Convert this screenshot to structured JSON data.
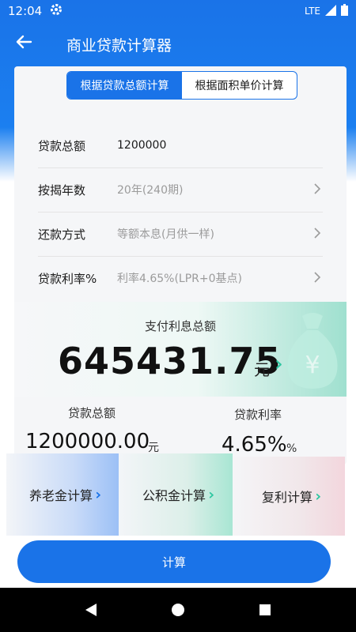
{
  "status": {
    "time": "12:04",
    "network": "LTE",
    "settings_icon": "gear-icon",
    "signal_icon": "signal-icon",
    "battery_icon": "battery-icon"
  },
  "header": {
    "title": "商业贷款计算器",
    "back_icon": "arrow-back-icon"
  },
  "tabs": {
    "selected": "根据贷款总额计算",
    "other": "根据面积单价计算"
  },
  "form": {
    "loan_total": {
      "label": "贷款总额",
      "value": "1200000"
    },
    "years": {
      "label": "按揭年数",
      "value": "20年(240期)"
    },
    "method": {
      "label": "还款方式",
      "value": "等额本息(月供一样)"
    },
    "rate": {
      "label": "贷款利率%",
      "value": "利率4.65%(LPR+0基点)"
    }
  },
  "result": {
    "interest_caption": "支付利息总额",
    "interest_value": "645431.75",
    "interest_unit": "元",
    "loan_caption": "贷款总额",
    "loan_value": "1200000.00",
    "loan_unit": "元",
    "rate_caption": "贷款利率",
    "rate_value": "4.65%",
    "rate_unit": "%"
  },
  "tools": [
    {
      "label": "养老金计算"
    },
    {
      "label": "公积金计算"
    },
    {
      "label": "复利计算"
    }
  ],
  "actions": {
    "calculate": "计算"
  },
  "colors": {
    "primary": "#1a73e8",
    "accent_green": "#2ec7a1"
  }
}
